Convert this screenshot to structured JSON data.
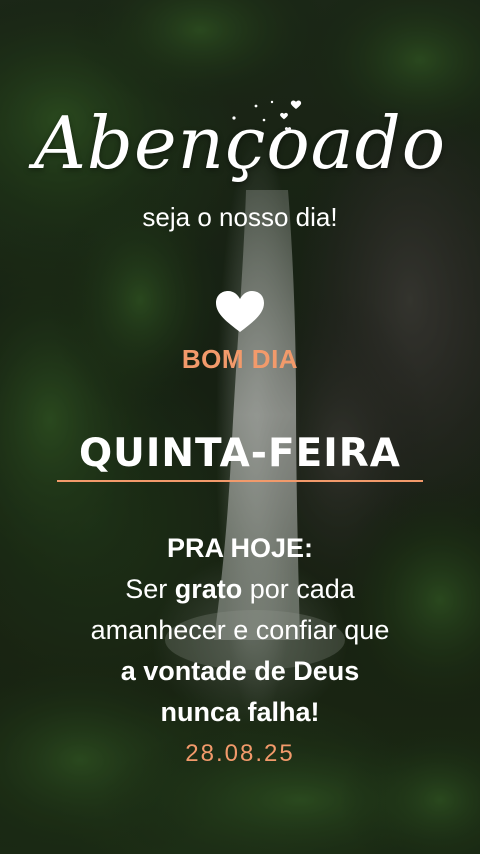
{
  "title": {
    "script": "Abençoado",
    "subtitle": "seja o nosso dia!"
  },
  "greeting": "BOM DIA",
  "weekday": "QUINTA-FEIRA",
  "message": {
    "heading": "PRA HOJE:",
    "line1_pre": "Ser ",
    "line1_bold": "grato",
    "line1_post": " por cada",
    "line2": "amanhecer e confiar que",
    "line3_bold": "a vontade de Deus",
    "line4_bold": "nunca falha!"
  },
  "date": "28.08.25",
  "colors": {
    "accent": "#f29a6b",
    "text": "#ffffff"
  },
  "icons": [
    "heart-icon",
    "sparkle-hearts-icon"
  ]
}
